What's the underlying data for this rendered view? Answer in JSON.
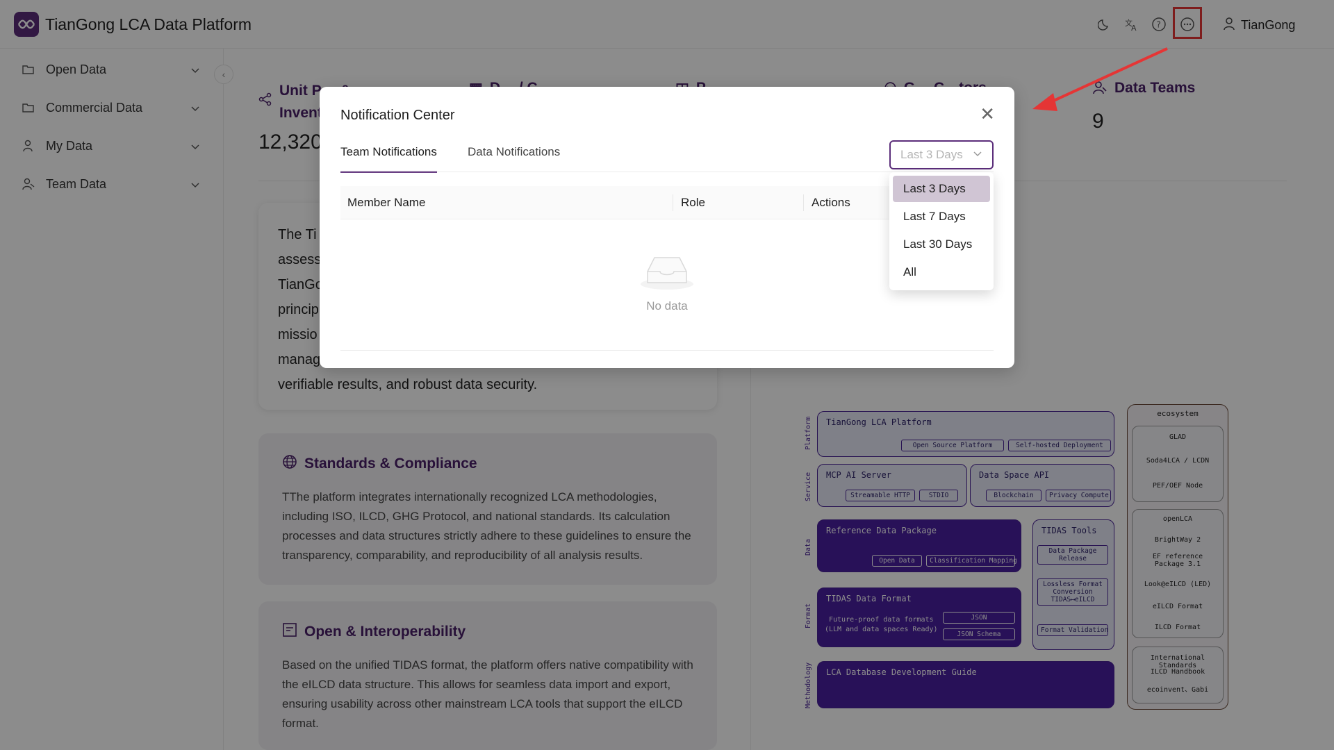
{
  "header": {
    "app_title": "TianGong LCA Data Platform",
    "user_name": "TianGong",
    "icons": [
      "moon-icon",
      "translate-icon",
      "help-icon",
      "notification-icon",
      "user-icon"
    ]
  },
  "sidebar": {
    "items": [
      {
        "label": "Open Data",
        "icon": "folder-open-icon"
      },
      {
        "label": "Commercial Data",
        "icon": "folder-icon"
      },
      {
        "label": "My Data",
        "icon": "user-icon"
      },
      {
        "label": "Team Data",
        "icon": "team-icon"
      }
    ]
  },
  "main": {
    "stats": [
      {
        "label": "Unit P… &",
        "label2": "Invent",
        "value": "12,320"
      },
      {
        "label": "D… / C…",
        "value": ""
      },
      {
        "label": "P…",
        "value": ""
      },
      {
        "label": "G… C…tors",
        "value": ""
      },
      {
        "label": "Data Teams",
        "value": "9"
      }
    ],
    "intro_lines": [
      "The Ti",
      "assess",
      "TianGo",
      "princip",
      "missio",
      "manag",
      "verifiable results, and robust data security."
    ],
    "standards": {
      "title": "Standards & Compliance",
      "body": "TThe platform integrates internationally recognized LCA methodologies, including ISO, ILCD, GHG Protocol, and national standards. Its calculation processes and data structures strictly adhere to these guidelines to ensure the transparency, comparability, and reproducibility of all analysis results."
    },
    "interop": {
      "title": "Open & Interoperability",
      "body": "Based on the unified TIDAS format, the platform offers native compatibility with the eILCD data structure. This allows for seamless data import and export, ensuring usability across other mainstream LCA tools that support the eILCD format."
    }
  },
  "diagram": {
    "layers": [
      "Platform",
      "Service",
      "Data",
      "Format",
      "Methodology"
    ],
    "platform": {
      "title": "TianGong LCA Platform",
      "pills": [
        "Open Source Platform",
        "Self-hosted Deployment"
      ]
    },
    "mcp": {
      "title": "MCP AI Server",
      "pills": [
        "Streamable HTTP",
        "STDIO"
      ]
    },
    "dataspace": {
      "title": "Data Space API",
      "pills": [
        "Blockchain",
        "Privacy Compute"
      ]
    },
    "refpkg": {
      "title": "Reference Data Package",
      "pills": [
        "Open Data",
        "Classification Mapping"
      ]
    },
    "tools": {
      "title": "TIDAS Tools",
      "pills": [
        "Data Package Release",
        "Lossless Format Conversion TIDAS⟷eILCD",
        "Format Validation"
      ]
    },
    "format": {
      "title": "TIDAS Data Format",
      "desc1": "Future-proof data formats",
      "desc2": "(LLM and data spaces Ready)",
      "pills": [
        "JSON",
        "JSON Schema"
      ]
    },
    "guide": {
      "title": "LCA Database Development Guide"
    },
    "ecosystem": {
      "title": "ecosystem",
      "group1": [
        "GLAD",
        "Soda4LCA / LCDN",
        "PEF/OEF Node"
      ],
      "group2": [
        "openLCA",
        "BrightWay 2",
        "EF reference Package 3.1",
        "Look@eILCD (LED)",
        "eILCD Format",
        "ILCD Format"
      ],
      "group3": [
        "International Standards",
        "ILCD Handbook",
        "ecoinvent、Gabi"
      ]
    }
  },
  "modal": {
    "title": "Notification Center",
    "tabs": [
      "Team Notifications",
      "Data Notifications"
    ],
    "active_tab": 0,
    "filter": {
      "placeholder": "Last 3 Days",
      "options": [
        "Last 3 Days",
        "Last 7 Days",
        "Last 30 Days",
        "All"
      ],
      "selected": 0
    },
    "columns": [
      "Member Name",
      "Role",
      "Actions"
    ],
    "empty_text": "No data"
  },
  "colors": {
    "brand": "#5b2d7a",
    "highlight": "#e53535",
    "diagram_dark": "#4a1fa0"
  }
}
